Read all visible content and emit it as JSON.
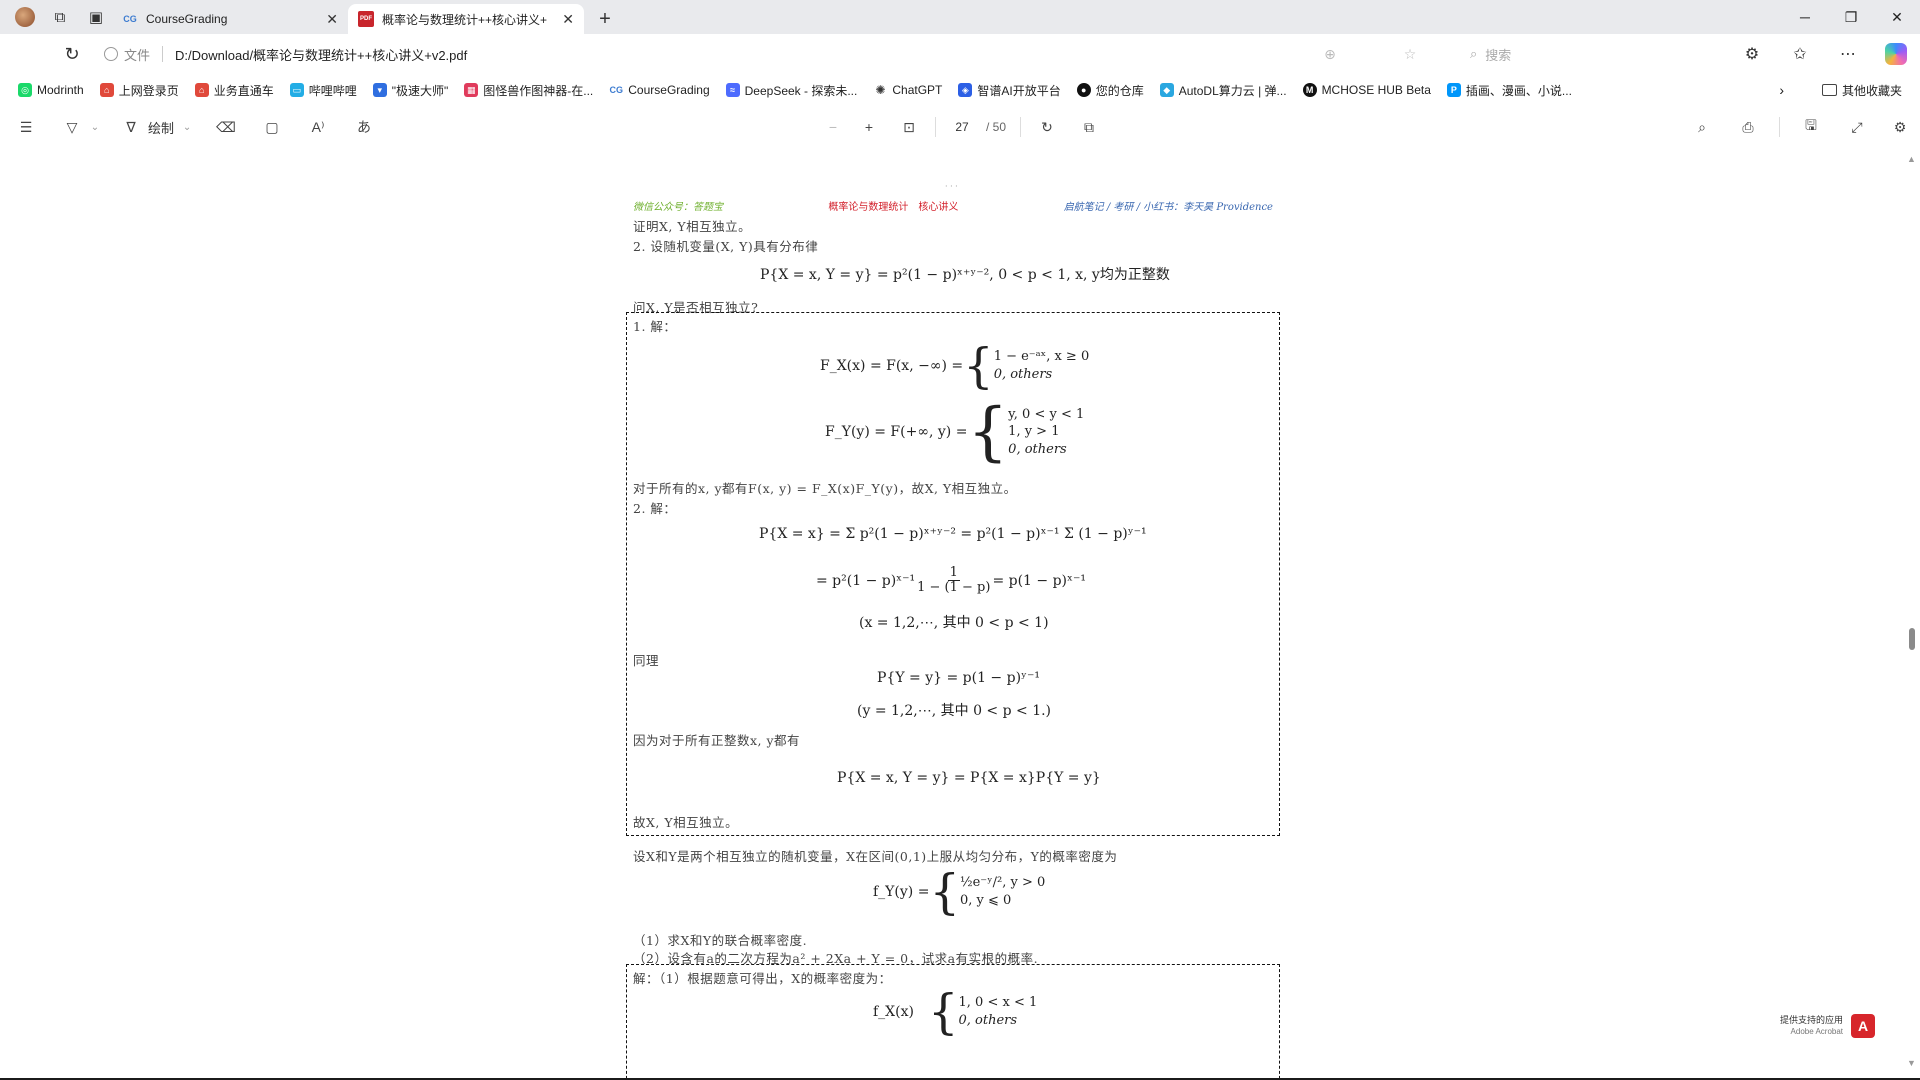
{
  "tabs": [
    {
      "favicon": "coursegrading-icon",
      "title": "CourseGrading",
      "active": false
    },
    {
      "favicon": "pdf-icon",
      "title": "概率论与数理统计++核心讲义+",
      "active": true
    }
  ],
  "address": {
    "site_label": "文件",
    "url": "D:/Download/概率论与数理统计++核心讲义+v2.pdf",
    "search_placeholder": "搜索"
  },
  "favorites": [
    {
      "label": "Modrinth",
      "icon": "modrinth-icon",
      "color": "#1bd96a"
    },
    {
      "label": "上网登录页",
      "icon": "login-icon",
      "color": "#e0493b"
    },
    {
      "label": "业务直通车",
      "icon": "business-icon",
      "color": "#e0493b"
    },
    {
      "label": "哔哩哔哩",
      "icon": "bilibili-icon",
      "color": "#23ade5"
    },
    {
      "label": "\"极速大师\"",
      "icon": "speed-icon",
      "color": "#2f6ee0"
    },
    {
      "label": "图怪兽作图神器-在...",
      "icon": "tuguaishou-icon",
      "color": "#e03b5c"
    },
    {
      "label": "CourseGrading",
      "icon": "coursegrading-icon",
      "color": "#3c7bd0"
    },
    {
      "label": "DeepSeek - 探索未...",
      "icon": "deepseek-icon",
      "color": "#4d6bfe"
    },
    {
      "label": "ChatGPT",
      "icon": "chatgpt-icon",
      "color": "#333333"
    },
    {
      "label": "智谱AI开放平台",
      "icon": "zhipu-icon",
      "color": "#2c5fe5"
    },
    {
      "label": "您的仓库",
      "icon": "github-icon",
      "color": "#111111"
    },
    {
      "label": "AutoDL算力云 | 弹...",
      "icon": "autodl-icon",
      "color": "#2aa7e0"
    },
    {
      "label": "MCHOSE HUB Beta",
      "icon": "mchose-icon",
      "color": "#111111"
    },
    {
      "label": "插画、漫画、小说...",
      "icon": "pixiv-icon",
      "color": "#0096fa"
    }
  ],
  "favorites_other": "其他收藏夹",
  "pdf_toolbar": {
    "draw_label": "绘制",
    "current_page": "27",
    "total_pages": "/ 50"
  },
  "page": {
    "header_left": "微信公众号：答题宝",
    "header_center": "概率论与数理统计　核心讲义",
    "header_right": "启航笔记 / 考研 / 小红书：李天昊 Providence",
    "line_prove": "证明X, Y相互独立。",
    "line_q2": "2.  设随机变量(X, Y)具有分布律",
    "eq_joint": "P{X = x, Y = y} = p²(1 − p)ˣ⁺ʸ⁻², 0 < p < 1, x, y均为正整数",
    "line_ask": "问X, Y是否相互独立?",
    "sol1_label": "1.  解：",
    "fx_lhs": "F_X(x) = F(x, −∞) =",
    "fx_case1": "1 − e⁻ᵃˣ,   x ≥ 0",
    "fx_case2": "0,             others",
    "fy_lhs": "F_Y(y) = F(+∞, y) =",
    "fy_case1": "y,   0 < y < 1",
    "fy_case2": "1,   y > 1",
    "fy_case3": "0,   others",
    "line_forall": "对于所有的x, y都有F(x, y) = F_X(x)F_Y(y)，故X, Y相互独立。",
    "sol2_label": "2.  解：",
    "px_line1": "P{X = x} = Σ p²(1 − p)ˣ⁺ʸ⁻² = p²(1 − p)ˣ⁻¹ Σ (1 − p)ʸ⁻¹",
    "px_line2_a": "= p²(1 − p)ˣ⁻¹",
    "px_line2_num": "1",
    "px_line2_den": "1 − (1 − p)",
    "px_line2_b": "= p(1 − p)ˣ⁻¹",
    "px_cond": "(x = 1,2,⋯, 其中 0 < p < 1)",
    "line_same": "同理",
    "py_eq": "P{Y = y} = p(1 − p)ʸ⁻¹",
    "py_cond": "(y = 1,2,⋯, 其中 0 < p < 1.)",
    "line_because": "因为对于所有正整数x, y都有",
    "pxy_eq": "P{X = x, Y = y} = P{X = x}P{Y = y}",
    "line_therefore": "故X, Y相互独立。",
    "line_q3": "设X和Y是两个相互独立的随机变量，X在区间(0,1)上服从均匀分布，Y的概率密度为",
    "fyy_lhs": "f_Y(y) =",
    "fyy_case1": "½e⁻ʸ/², y > 0",
    "fyy_case2": "0,          y ⩽ 0",
    "line_q3_1": "（1）求X和Y的联合概率密度.",
    "line_q3_2": "（2）设含有a的二次方程为a² + 2Xa + Y = 0，试求a有实根的概率.",
    "line_sol3": "解：（1）根据题意可得出，X的概率密度为：",
    "fx2_lhs": "f_X(x)",
    "fx2_case1": "1,  0 < x < 1",
    "fx2_case2": "0,  others"
  },
  "acrobat": {
    "line1": "提供支持的应用",
    "line2": "Adobe Acrobat"
  }
}
